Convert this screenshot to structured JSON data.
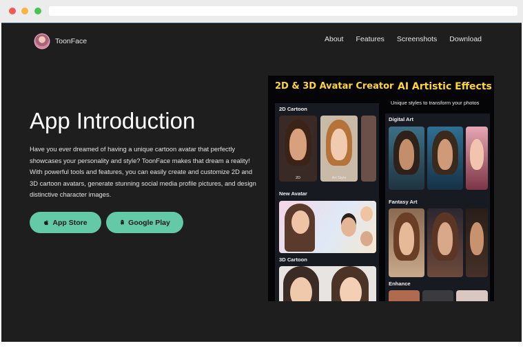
{
  "brand": {
    "name": "ToonFace"
  },
  "nav": {
    "items": [
      "About",
      "Features",
      "Screenshots",
      "Download"
    ]
  },
  "hero": {
    "title": "App Introduction",
    "description": "Have you ever dreamed of having a unique cartoon avatar that perfectly showcases your personality and style? ToonFace makes that dream a reality! With powerful tools and features, you can easily create and customize 2D and 3D cartoon avatars, generate stunning social media profile pictures, and design distinctive character images.",
    "buttons": {
      "app_store": "App Store",
      "google_play": "Google Play"
    }
  },
  "showcase": {
    "left_heading": "2D & 3D Avatar Creator",
    "right_heading": "AI  Artistic Effects",
    "right_subtitle": "Unique styles to transform your photos",
    "left_categories": [
      "2D Cartoon",
      "New Avatar",
      "3D Cartoon"
    ],
    "right_categories": [
      "Digital Art",
      "Fantasy Art",
      "Enhance"
    ],
    "thumb_tags": [
      "2D",
      "Art Style"
    ]
  },
  "colors": {
    "page_bg": "#1e1e1e",
    "accent": "#64c9a7",
    "heading_yellow": "#ffd43b"
  }
}
